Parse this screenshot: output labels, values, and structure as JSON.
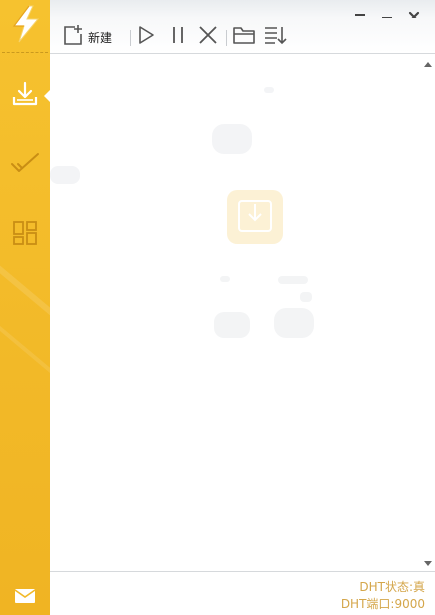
{
  "sidebar": {
    "logo": "lightning-logo",
    "items": [
      {
        "id": "downloading",
        "icon": "download-icon",
        "active": true
      },
      {
        "id": "completed",
        "icon": "checkmark-icon",
        "active": false
      },
      {
        "id": "apps",
        "icon": "grid-icon",
        "active": false
      }
    ],
    "bottom": {
      "icon": "mail-icon"
    }
  },
  "window_controls": [
    {
      "id": "menu",
      "icon": "dropdown-menu-icon"
    },
    {
      "id": "minimize",
      "icon": "minimize-icon"
    },
    {
      "id": "close",
      "icon": "close-icon"
    }
  ],
  "toolbar": {
    "new_label": "新建",
    "buttons": [
      {
        "id": "new",
        "icon": "new-task-icon"
      },
      {
        "id": "start",
        "icon": "play-icon"
      },
      {
        "id": "pause",
        "icon": "pause-icon"
      },
      {
        "id": "delete",
        "icon": "delete-icon"
      },
      {
        "id": "open-folder",
        "icon": "folder-icon"
      },
      {
        "id": "sort",
        "icon": "sort-list-icon"
      }
    ]
  },
  "content": {
    "empty_state_icon": "download-box-icon"
  },
  "status": {
    "dht_state": "DHT状态:真",
    "dht_port": "DHT端口:9000"
  },
  "colors": {
    "sidebar": "#f2b928",
    "status_text": "#d4a64a",
    "icon": "#555555"
  }
}
